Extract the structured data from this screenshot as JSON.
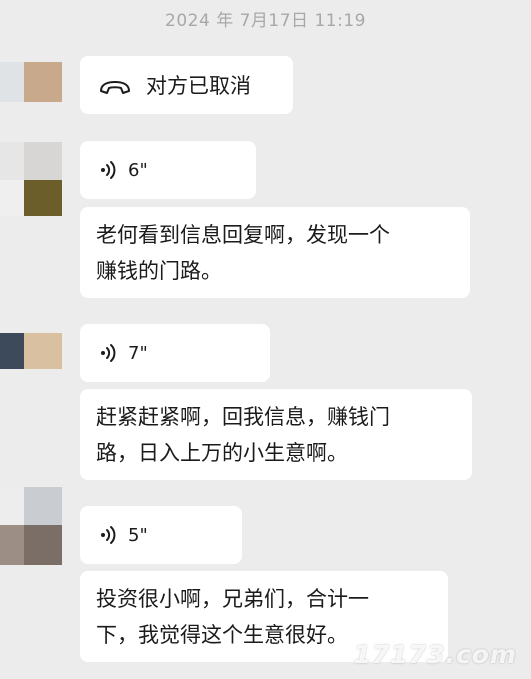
{
  "chat": {
    "timestamp": "2024 年 7月17日 11:19",
    "call_status": "对方已取消",
    "messages": [
      {
        "type": "voice",
        "duration": "6\""
      },
      {
        "type": "text",
        "text": "老何看到信息回复啊，发现一个\n赚钱的门路。"
      },
      {
        "type": "voice",
        "duration": "7\""
      },
      {
        "type": "text",
        "text": "赶紧赶紧啊，回我信息，赚钱门\n路，日入上万的小生意啊。"
      },
      {
        "type": "voice",
        "duration": "5\""
      },
      {
        "type": "text",
        "text": "投资很小啊，兄弟们，合计一\n下，我觉得这个生意很好。"
      }
    ]
  },
  "watermark": "17173.com",
  "icons": {
    "call": "hangup-phone-icon",
    "voice": "voice-wave-icon"
  },
  "colors": {
    "background": "#ececec",
    "bubble": "#ffffff",
    "text": "#1b1b1b",
    "timestamp": "#a8a8a8"
  }
}
